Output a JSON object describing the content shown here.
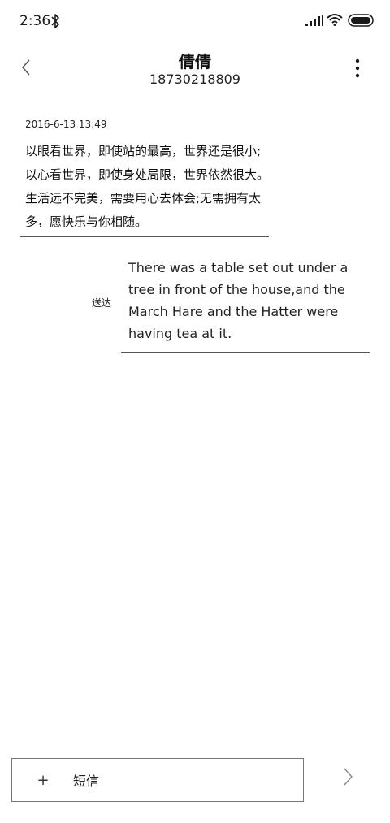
{
  "status_bar": {
    "time": "2:36",
    "icons": [
      "bluetooth-icon",
      "signal-icon",
      "wifi-icon",
      "battery-icon"
    ]
  },
  "header": {
    "title": "倩倩",
    "subtitle": "18730218809",
    "back_icon": "chevron-left-icon",
    "more_icon": "more-vertical-icon"
  },
  "messages": [
    {
      "timestamp": "2016-6-13 13:49",
      "text": "以眼看世界，即使站的最高，世界还是很小;以心看世界，即使身处局限，世界依然很大。生活远不完美，需要用心去体会;无需拥有太多，愿快乐与你相随。"
    },
    {
      "status": "送达",
      "text": "There was a table set out under a tree in front of the house,and the March Hare and the Hatter were having tea at it."
    }
  ],
  "compose": {
    "add_label": "+",
    "placeholder": "短信",
    "send_icon": "chevron-right-icon"
  },
  "colors": {
    "text": "#1a1a1a",
    "divider": "#555555",
    "background": "#ffffff"
  }
}
